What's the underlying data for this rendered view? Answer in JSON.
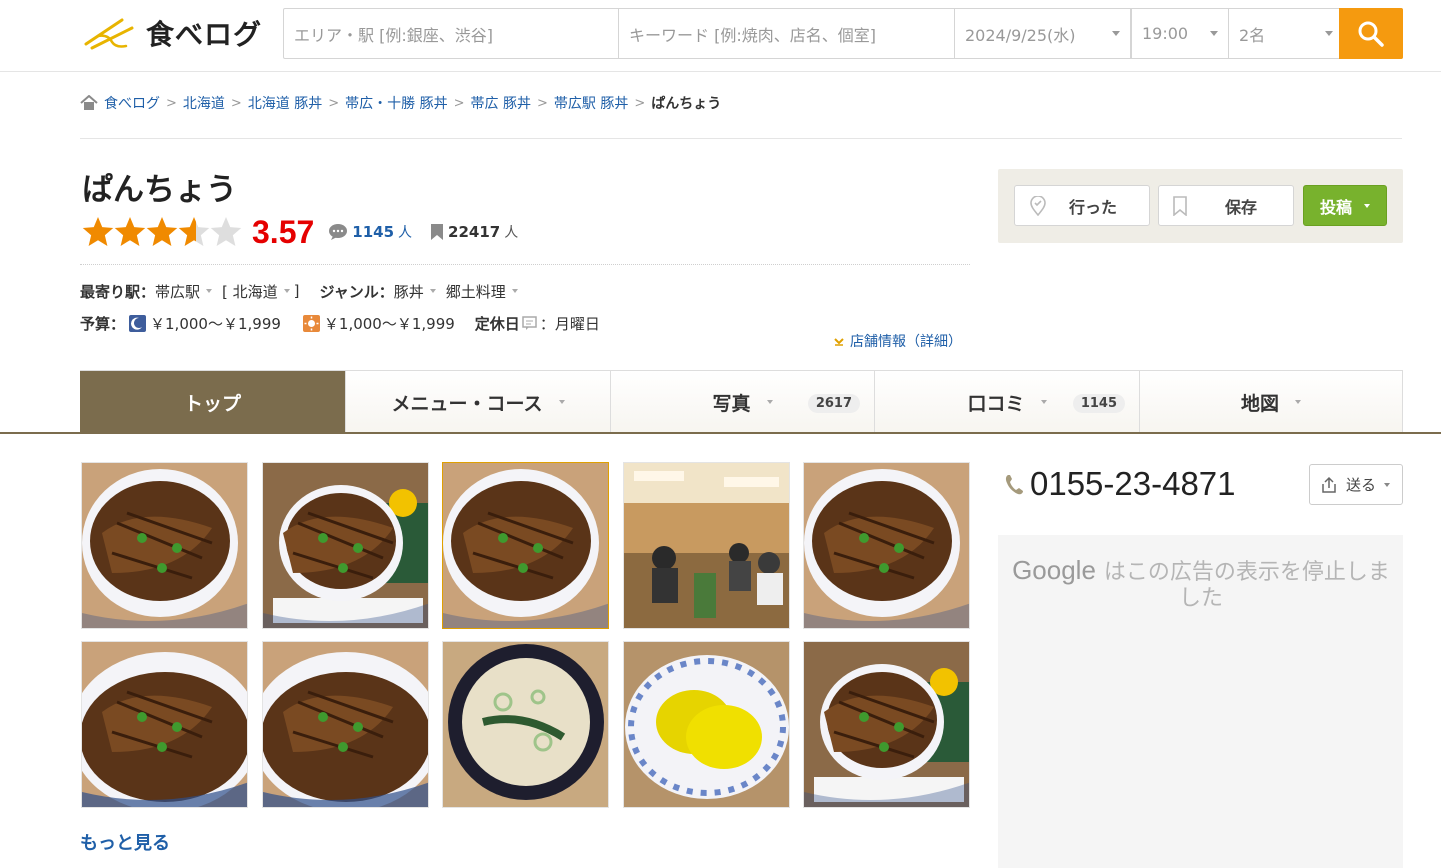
{
  "header": {
    "logo_text": "食べログ",
    "search": {
      "area_placeholder": "エリア・駅 [例:銀座、渋谷]",
      "keyword_placeholder": "キーワード [例:焼肉、店名、個室]",
      "date": "2024/9/25(水)",
      "time": "19:00",
      "people": "2名"
    }
  },
  "breadcrumb": {
    "items": [
      "食べログ",
      "北海道",
      "北海道 豚丼",
      "帯広・十勝 豚丼",
      "帯広 豚丼",
      "帯広駅 豚丼"
    ],
    "current": "ぱんちょう"
  },
  "restaurant": {
    "name": "ぱんちょう",
    "rating_score": "3.57",
    "rating_value": 3.57,
    "review_count": "1145",
    "review_unit": "人",
    "save_count": "22417",
    "save_unit": "人",
    "nearest_station_label": "最寄り駅：",
    "nearest_station": "帯広駅",
    "region_bracket": "[ 北海道",
    "region_close": "]",
    "genre_label": "ジャンル：",
    "genres": [
      "豚丼",
      "郷土料理"
    ],
    "budget_label": "予算：",
    "budget_dinner": "￥1,000～￥1,999",
    "budget_lunch": "￥1,000～￥1,999",
    "holiday_label": "定休日",
    "holiday_sep": "：",
    "holiday": "月曜日",
    "detail_link": "店舗情報（詳細）"
  },
  "actions": {
    "went": "行った",
    "save": "保存",
    "post": "投稿"
  },
  "tabs": [
    {
      "label": "トップ",
      "badge": ""
    },
    {
      "label": "メニュー・コース",
      "badge": ""
    },
    {
      "label": "写真",
      "badge": "2617"
    },
    {
      "label": "口コミ",
      "badge": "1145"
    },
    {
      "label": "地図",
      "badge": ""
    }
  ],
  "more_link": "もっと見る",
  "phone": "0155-23-4871",
  "send_label": "送る",
  "ad": {
    "google": "Google",
    "message": "はこの広告の表示を停止しました"
  },
  "colors": {
    "accent_orange": "#f59a0f",
    "score_red": "#e50000",
    "tab_active": "#7b6c4d",
    "post_green": "#78b22d",
    "link_blue": "#1f5fa8"
  }
}
